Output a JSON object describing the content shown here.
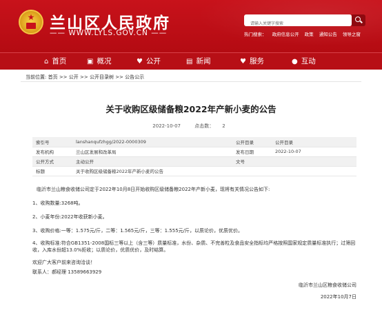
{
  "header": {
    "site_title": "兰山区人民政府",
    "site_url": "—— WWW.LYLS.GOV.CN ——",
    "search_placeholder": "请输入关键字搜索",
    "hot_label": "热门搜索：",
    "hot_items": [
      "政府信息公开",
      "政策",
      "通知公告",
      "领导之窗"
    ],
    "brand_color": "#c8121b"
  },
  "nav": {
    "items": [
      {
        "icon": "home-icon",
        "label": "首页"
      },
      {
        "icon": "overview-icon",
        "label": "概况"
      },
      {
        "icon": "public-icon",
        "label": "公开"
      },
      {
        "icon": "news-icon",
        "label": "新闻"
      },
      {
        "icon": "service-icon",
        "label": "服务"
      },
      {
        "icon": "interact-icon",
        "label": "互动"
      }
    ]
  },
  "breadcrumb": {
    "prefix": "当前位置:",
    "path": [
      "首页",
      "公开",
      "公开目录树",
      "公告公示"
    ],
    "separator": " >> "
  },
  "article": {
    "title": "关于收购区级储备粮2022年产新小麦的公告",
    "date": "2022-10-07",
    "clicks_label": "点击数：",
    "clicks": "2",
    "meta": [
      {
        "k1": "索引号",
        "v1": "lanshanqufzhgg/2022-0000309",
        "k2": "公开目录",
        "v2": "公开目录"
      },
      {
        "k1": "发布机构",
        "v1": "兰山区发展和改革局",
        "k2": "发布日期",
        "v2": "2022-10-07"
      },
      {
        "k1": "公开方式",
        "v1": "主动公开",
        "k2": "文号",
        "v2": ""
      },
      {
        "k1": "标题",
        "v1": "关于收购区级储备粮2022年产新小麦的公告",
        "k2": "",
        "v2": ""
      }
    ],
    "paragraphs": [
      "临沂市兰山粮食收储公司定于2022年10月8日开始收购区级储备粮2022年产新小麦，现将有关情况公告如下:",
      "1、收购数量:3268吨。",
      "2、小麦年份:2022年收获新小麦。",
      "3、收购价格:一等：1.575元/斤，二等：1.565元/斤，三等：1.555元/斤，以质论价，优质优价。",
      "4、收购标准:符合GB1351-2008国标三等以上（含三等）质量标准，水份、杂质、不完善粒及食品安全指标均严格按照国家规定质量标准执行；过筛回收，入库水份超13.0%拒收；以质论价，优质优价，及时结算。",
      "欢迎广大客户前来咨询洽谈！",
      "联系人：郝经理 13589663929"
    ],
    "signature_org": "临沂市兰山区粮食收储公司",
    "signature_date": "2022年10月7日"
  }
}
